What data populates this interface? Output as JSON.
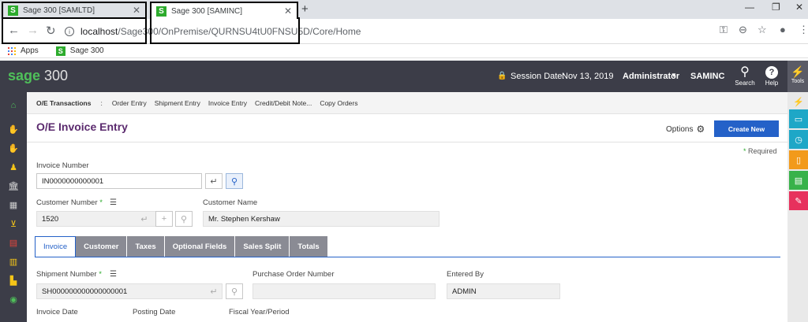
{
  "browser": {
    "tabs": [
      {
        "title": "Sage 300 [SAMLTD]",
        "close": "✕"
      },
      {
        "title": "Sage 300 [SAMINC]",
        "close": "✕"
      }
    ],
    "new_tab": "+",
    "window_controls": [
      "—",
      "❐",
      "✕"
    ],
    "url_host": "localhost",
    "url_path": "/Sage300/OnPremise/QURNSU4tU0FNSU5D/Core/Home",
    "bookmarks": [
      {
        "label": "Apps"
      },
      {
        "label": "Sage 300"
      }
    ]
  },
  "app": {
    "logo_brand": "sage",
    "logo_number": " 300",
    "session_date_label": "Session Date:",
    "session_date": "Nov 13, 2019",
    "user": "Administrator",
    "company": "SAMINC",
    "search_label": "Search",
    "help_label": "Help",
    "tools_label": "Tools"
  },
  "subnav": {
    "crumb": "O/E Transactions",
    "separator": ":",
    "links": [
      "Order Entry",
      "Shipment Entry",
      "Invoice Entry",
      "Credit/Debit Note...",
      "Copy Orders"
    ]
  },
  "page": {
    "title": "O/E Invoice Entry",
    "options_label": "Options",
    "create_label": "Create New",
    "required_star": "*",
    "required_text": " Required"
  },
  "form": {
    "invoice_number_label": "Invoice Number",
    "invoice_number_value": "IN0000000000001",
    "customer_number_label": "Customer Number",
    "customer_number_value": "1520",
    "customer_name_label": "Customer Name",
    "customer_name_value": "Mr. Stephen Kershaw",
    "shipment_number_label": "Shipment Number",
    "shipment_number_value": "SH000000000000000001",
    "po_number_label": "Purchase Order Number",
    "po_number_value": "",
    "entered_by_label": "Entered By",
    "entered_by_value": "ADMIN",
    "invoice_date_label": "Invoice Date",
    "posting_date_label": "Posting Date",
    "fiscal_label": "Fiscal Year/Period",
    "required_star": "*"
  },
  "tabs": [
    {
      "label": "Invoice"
    },
    {
      "label": "Customer"
    },
    {
      "label": "Taxes"
    },
    {
      "label": "Optional Fields"
    },
    {
      "label": "Sales Split"
    },
    {
      "label": "Totals"
    }
  ],
  "colors": {
    "header_bg": "#3c3d48",
    "brand_green": "#4fc05a",
    "title_purple": "#5b2a6e",
    "primary_blue": "#2461c8"
  }
}
